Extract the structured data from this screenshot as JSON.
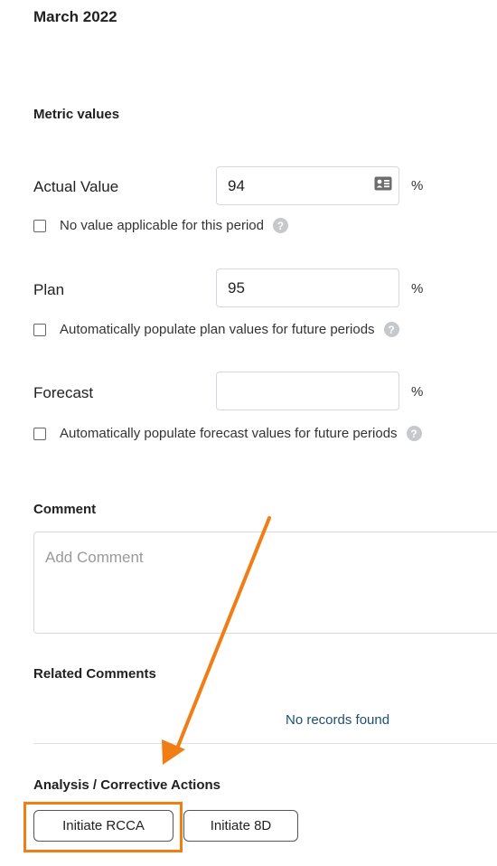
{
  "period": {
    "title": "March 2022"
  },
  "metric_values": {
    "heading": "Metric values",
    "actual": {
      "label": "Actual Value",
      "value": "94",
      "unit": "%",
      "checkbox_label": "No value applicable for this period"
    },
    "plan": {
      "label": "Plan",
      "value": "95",
      "unit": "%",
      "checkbox_label": "Automatically populate plan values for future periods"
    },
    "forecast": {
      "label": "Forecast",
      "value": "",
      "unit": "%",
      "checkbox_label": "Automatically populate forecast values for future periods"
    }
  },
  "comment": {
    "heading": "Comment",
    "placeholder": "Add Comment"
  },
  "related_comments": {
    "heading": "Related Comments",
    "empty_text": "No records found"
  },
  "analysis": {
    "heading": "Analysis / Corrective Actions",
    "buttons": [
      "Initiate RCCA",
      "Initiate 8D"
    ]
  },
  "icons": {
    "help": "question-circle-icon",
    "contact_card": "contact-card-icon",
    "annotation_arrow": "arrow-icon"
  },
  "colors": {
    "annotation": "#f07e14",
    "link_text": "#1d4e72",
    "help_icon": "#c6c9cc"
  }
}
